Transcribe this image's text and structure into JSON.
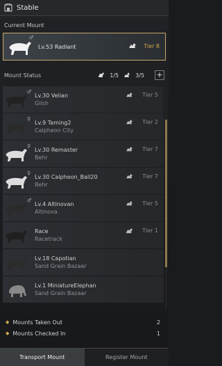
{
  "window": {
    "title": "Stable"
  },
  "current_mount": {
    "section_label": "Current Mount",
    "name": "Lv.53 Radiant",
    "tier": "Tier 8",
    "gender_symbol": "♂"
  },
  "status": {
    "label": "Mount Status",
    "count1": "1/5",
    "count2": "3/5",
    "add_label": "+"
  },
  "mounts": [
    {
      "name": "Lv.30 Velian",
      "location": "Glish",
      "tier": "Tier 5",
      "gender": "♂",
      "color": "#222"
    },
    {
      "name": "Lv.9 Taming2",
      "location": "Calpheon City",
      "tier": "Tier 2",
      "gender": "♀",
      "color": "#2a2a2a"
    },
    {
      "name": "Lv.30 Remaster",
      "location": "Behr",
      "tier": "Tier 7",
      "gender": "♀",
      "color": "#ddd"
    },
    {
      "name": "Lv.30 Calpheon_Ball20",
      "location": "Behr",
      "tier": "Tier 7",
      "gender": "♀",
      "color": "#ddd"
    },
    {
      "name": "Lv.4 Altinovan",
      "location": "Altinova",
      "tier": "Tier 5",
      "gender": "♂",
      "color": "#2a2a2a"
    },
    {
      "name": "Race",
      "location": "Racetrack",
      "tier": "Tier 1",
      "gender": "",
      "color": "#1f1f1f"
    },
    {
      "name": "Lv.18 Capotian",
      "location": "Sand Grain Bazaar",
      "tier": "",
      "gender": "",
      "color": "#2b2b2b"
    },
    {
      "name": "Lv.1 MiniatureElephan",
      "location": "Sand Grain Bazaar",
      "tier": "",
      "gender": "",
      "color": "#888"
    }
  ],
  "summary": {
    "taken_label": "Mounts Taken Out",
    "taken_value": "2",
    "checked_label": "Mounts Checked In",
    "checked_value": "1"
  },
  "tabs": {
    "transport": "Transport Mount",
    "register": "Register Mount"
  }
}
